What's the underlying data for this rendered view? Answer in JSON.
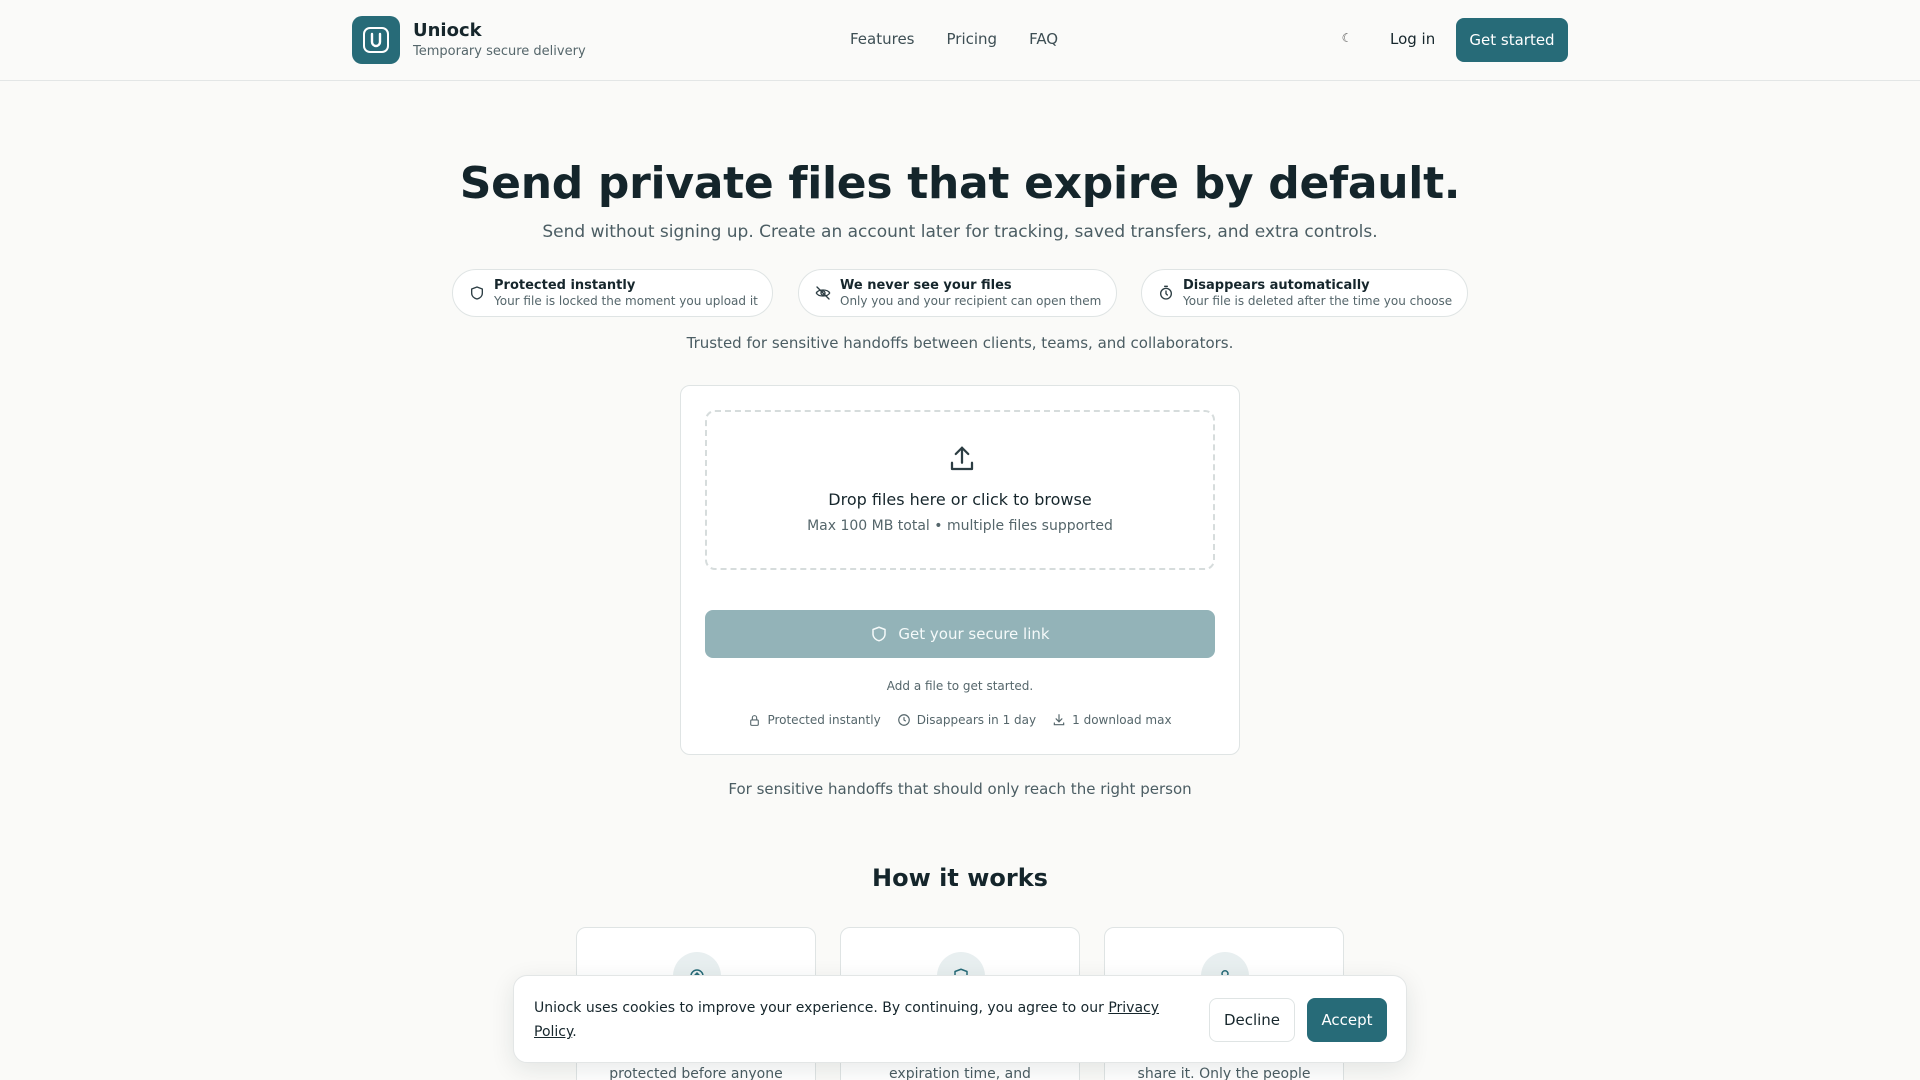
{
  "colors": {
    "brand": "#276b78",
    "background": "#fafaf8",
    "text": "#16262c",
    "muted": "#4b5d63",
    "disabled_button": "#93b3b8"
  },
  "header": {
    "brand_name": "Uniock",
    "brand_tagline": "Temporary secure delivery",
    "logo_icon": "lock-u-icon",
    "nav": [
      {
        "label": "Features"
      },
      {
        "label": "Pricing"
      },
      {
        "label": "FAQ"
      }
    ],
    "theme_toggle_icon": "moon-icon",
    "theme_toggle_glyph": "☾",
    "login_label": "Log in",
    "cta_label": "Get started"
  },
  "hero": {
    "title": "Send private files that expire by default.",
    "subtitle": "Send without signing up. Create an account later for tracking, saved transfers, and extra controls.",
    "features": [
      {
        "icon": "shield-icon",
        "title": "Protected instantly",
        "desc": "Your file is locked the moment you upload it"
      },
      {
        "icon": "eye-off-icon",
        "title": "We never see your files",
        "desc": "Only you and your recipient can open them"
      },
      {
        "icon": "timer-icon",
        "title": "Disappears automatically",
        "desc": "Your file is deleted after the time you choose"
      }
    ],
    "trusted": "Trusted for sensitive handoffs between clients, teams, and collaborators."
  },
  "upload": {
    "drop_icon": "upload-icon",
    "drop_title": "Drop files here or click to browse",
    "drop_subtitle": "Max 100 MB total • multiple files supported",
    "button_label": "Get your secure link",
    "hint": "Add a file to get started.",
    "meta": [
      {
        "icon": "lock-icon",
        "label": "Protected instantly"
      },
      {
        "icon": "clock-icon",
        "label": "Disappears in 1 day"
      },
      {
        "icon": "download-icon",
        "label": "1 download max"
      }
    ]
  },
  "handoff_note": "For sensitive handoffs that should only reach the right person",
  "how_it_works": {
    "title": "How it works",
    "steps": [
      {
        "icon": "upload-circle-icon",
        "text": "protected before anyone"
      },
      {
        "icon": "shield-icon",
        "text": "expiration time, and"
      },
      {
        "icon": "key-icon",
        "text": "share it. Only the people"
      }
    ]
  },
  "cookie": {
    "text": "Uniock uses cookies to improve your experience. By continuing, you agree to our ",
    "link": "Privacy Policy",
    "end": ".",
    "decline_label": "Decline",
    "accept_label": "Accept"
  }
}
